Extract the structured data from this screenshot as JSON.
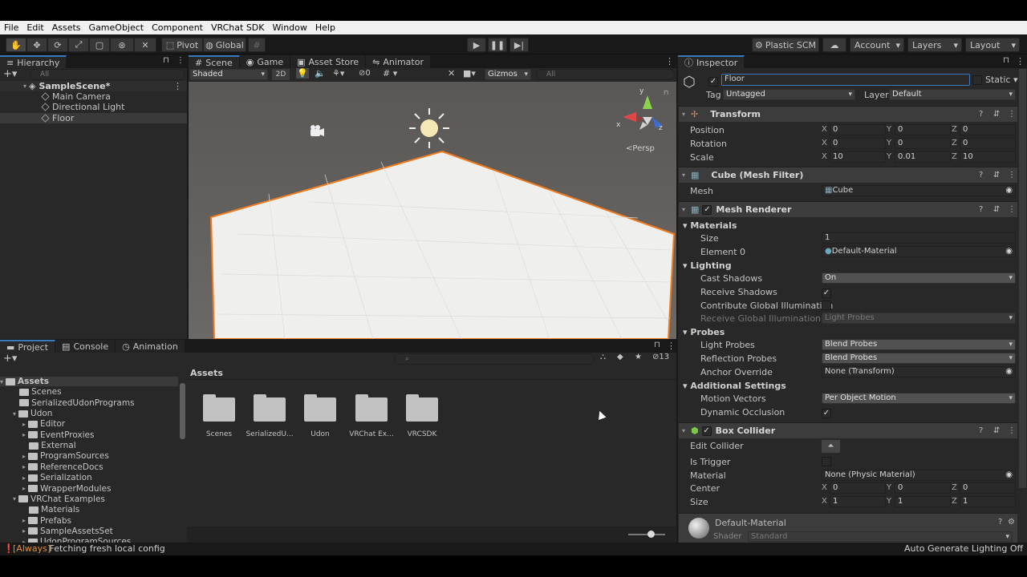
{
  "menu": [
    "File",
    "Edit",
    "Assets",
    "GameObject",
    "Component",
    "VRChat SDK",
    "Window",
    "Help"
  ],
  "toolbar": {
    "pivot": "Pivot",
    "global": "Global",
    "plastic": "Plastic SCM",
    "account": "Account",
    "layers": "Layers",
    "layout": "Layout"
  },
  "hierarchy": {
    "tab": "Hierarchy",
    "search_placeholder": "All",
    "scene": "SampleScene*",
    "items": [
      "Main Camera",
      "Directional Light",
      "Floor"
    ]
  },
  "scene_view": {
    "tabs": [
      "Scene",
      "Game",
      "Asset Store",
      "Animator"
    ],
    "shading": "Shaded",
    "mode_2d": "2D",
    "hidden_count": "0",
    "gizmos": "Gizmos",
    "search_placeholder": "All",
    "persp": "Persp",
    "axis_y": "y",
    "axis_x": "x",
    "axis_z": "z"
  },
  "project": {
    "tabs": [
      "Project",
      "Console",
      "Animation"
    ],
    "count": "13",
    "breadcrumb": "Assets",
    "tree": [
      {
        "label": "Assets",
        "depth": 0,
        "bold": true
      },
      {
        "label": "Scenes",
        "depth": 1
      },
      {
        "label": "SerializedUdonPrograms",
        "depth": 1
      },
      {
        "label": "Udon",
        "depth": 1
      },
      {
        "label": "Editor",
        "depth": 2
      },
      {
        "label": "EventProxies",
        "depth": 2
      },
      {
        "label": "External",
        "depth": 2
      },
      {
        "label": "ProgramSources",
        "depth": 2
      },
      {
        "label": "ReferenceDocs",
        "depth": 2
      },
      {
        "label": "Serialization",
        "depth": 2
      },
      {
        "label": "WrapperModules",
        "depth": 2
      },
      {
        "label": "VRChat Examples",
        "depth": 1
      },
      {
        "label": "Materials",
        "depth": 2
      },
      {
        "label": "Prefabs",
        "depth": 2
      },
      {
        "label": "SampleAssetsSet",
        "depth": 2
      },
      {
        "label": "UdonProgramSources",
        "depth": 2
      }
    ],
    "folders": [
      "Scenes",
      "SerializedU...",
      "Udon",
      "VRChat Ex...",
      "VRCSDK"
    ]
  },
  "inspector": {
    "tab": "Inspector",
    "object_name": "Floor",
    "static_label": "Static",
    "tag_label": "Tag",
    "tag_value": "Untagged",
    "layer_label": "Layer",
    "layer_value": "Default",
    "transform": {
      "title": "Transform",
      "position_label": "Position",
      "rotation_label": "Rotation",
      "scale_label": "Scale",
      "position": [
        "0",
        "0",
        "0"
      ],
      "rotation": [
        "0",
        "0",
        "0"
      ],
      "scale": [
        "10",
        "0.01",
        "10"
      ]
    },
    "mesh_filter": {
      "title": "Cube (Mesh Filter)",
      "mesh_label": "Mesh",
      "mesh_value": "Cube"
    },
    "mesh_renderer": {
      "title": "Mesh Renderer",
      "materials": "Materials",
      "size_label": "Size",
      "size_value": "1",
      "element0_label": "Element 0",
      "element0_value": "Default-Material",
      "lighting": "Lighting",
      "cast_shadows_label": "Cast Shadows",
      "cast_shadows_value": "On",
      "receive_shadows_label": "Receive Shadows",
      "contribute_gi_label": "Contribute Global Illumination",
      "receive_gi_label": "Receive Global Illumination",
      "receive_gi_value": "Light Probes",
      "probes": "Probes",
      "light_probes_label": "Light Probes",
      "light_probes_value": "Blend Probes",
      "reflection_probes_label": "Reflection Probes",
      "reflection_probes_value": "Blend Probes",
      "anchor_label": "Anchor Override",
      "anchor_value": "None (Transform)",
      "additional": "Additional Settings",
      "motion_vectors_label": "Motion Vectors",
      "motion_vectors_value": "Per Object Motion",
      "dynamic_occlusion_label": "Dynamic Occlusion"
    },
    "box_collider": {
      "title": "Box Collider",
      "edit_label": "Edit Collider",
      "trigger_label": "Is Trigger",
      "material_label": "Material",
      "material_value": "None (Physic Material)",
      "center_label": "Center",
      "center": [
        "0",
        "0",
        "0"
      ],
      "size_label": "Size",
      "size": [
        "1",
        "1",
        "1"
      ]
    },
    "material": {
      "name": "Default-Material",
      "shader_label": "Shader",
      "shader_value": "Standard"
    }
  },
  "status": {
    "tag": "[Always]",
    "message": " Fetching fresh local config",
    "right": "Auto Generate Lighting Off"
  },
  "colors": {
    "accent": "#3a79bb",
    "selection_outline": "#f07a1e",
    "floor": "#efefed"
  }
}
